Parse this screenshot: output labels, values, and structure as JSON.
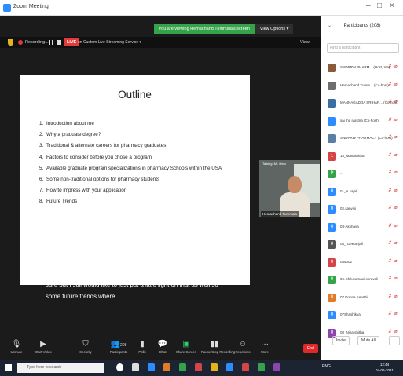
{
  "window": {
    "title": "Zoom Meeting",
    "minimize": "–",
    "maximize": "□",
    "close": "×"
  },
  "share_banner": {
    "text": "You are viewing Hemachand Tummala's screen",
    "view_options": "View Options ▾"
  },
  "top_strip": {
    "recording": "Recording...",
    "live": "LIVE",
    "live_service": "on Custom Live Streaming Service ▾",
    "view": "View"
  },
  "slide": {
    "title": "Outline",
    "items": [
      {
        "num": "1.",
        "text": "Introduction about me"
      },
      {
        "num": "2.",
        "text": "Why a graduate degree?"
      },
      {
        "num": "3.",
        "text": "Traditional & alternate careers for pharmacy graduates"
      },
      {
        "num": "4.",
        "text": "Factors to consider before you chose a program"
      },
      {
        "num": "5.",
        "text": "Available graduate program specializations in pharmacy Schools within the USA"
      },
      {
        "num": "6.",
        "text": "Some non-traditional options for pharmacy students"
      },
      {
        "num": "7.",
        "text": "How to impress with your application"
      },
      {
        "num": "8.",
        "text": "Future Trends"
      }
    ]
  },
  "video": {
    "top_label": "Talking: Mr. Hem",
    "name": "Hemachand Tummala"
  },
  "captions": [
    "sure but I still would like to just put a little light on that as well so",
    "some future trends where"
  ],
  "toolbar": {
    "unmute": "Unmute",
    "start_video": "Start Video",
    "security": "Security",
    "participants": "Participants",
    "participants_count": "208",
    "polls": "Polls",
    "chat": "Chat",
    "share_screen": "Share Screen",
    "pause_recording": "Pause/Stop Recording",
    "reactions": "Reactions",
    "more": "More",
    "end": "End"
  },
  "participants_panel": {
    "title": "Participants (208)",
    "search_placeholder": "Find a participant",
    "list": [
      {
        "name": "SNDPRW PHARM... (Host, me)",
        "initial": "",
        "color": "#8a5a3c"
      },
      {
        "name": "Hemachand Tumm... (Co-host)",
        "initial": "",
        "color": "#6d6d6d"
      },
      {
        "name": "MANNAGADDA SRIHAR... (Co-host)",
        "initial": "",
        "color": "#3a6ea5"
      },
      {
        "name": "sai tha jyostna (Co-host)",
        "initial": "",
        "color": "#2d8cff"
      },
      {
        "name": "SNDPRW PHARMACY (Co-host)",
        "initial": "",
        "color": "#5b7ea3"
      },
      {
        "name": "15_Manasvitha",
        "initial": "1",
        "color": "#d64545"
      },
      {
        "name": "...",
        "initial": "P",
        "color": "#35a34a"
      },
      {
        "name": "01_A.kajal",
        "initial": "0",
        "color": "#2d8cff"
      },
      {
        "name": "02.sanvini",
        "initial": "0",
        "color": "#2d8cff"
      },
      {
        "name": "03-Akshaya",
        "initial": "0",
        "color": "#2d8cff"
      },
      {
        "name": "04_ Geetanjali",
        "initial": "0",
        "color": "#555555"
      },
      {
        "name": "049002",
        "initial": "0",
        "color": "#d64545"
      },
      {
        "name": "06. chiluvamani shravali",
        "initial": "0",
        "color": "#35a34a"
      },
      {
        "name": "07 Donna Keerthi",
        "initial": "0",
        "color": "#e07b2a"
      },
      {
        "name": "07Shashikya",
        "initial": "0",
        "color": "#2d8cff"
      },
      {
        "name": "08_Niharshitha",
        "initial": "0",
        "color": "#8e44ad"
      }
    ],
    "invite": "Invite",
    "mute_all": "Mute All",
    "more": "..."
  },
  "taskbar": {
    "search_placeholder": "Type here to search",
    "tray": "ENG",
    "time": "12:44",
    "date": "04-06-2021"
  }
}
